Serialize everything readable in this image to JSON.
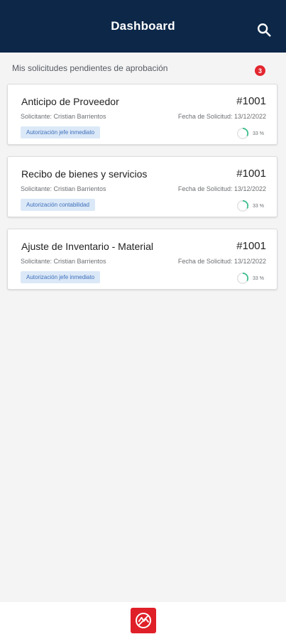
{
  "header": {
    "title": "Dashboard",
    "search_icon": "search-icon"
  },
  "section": {
    "title": "Mis solicitudes pendientes de aprobación",
    "count": "3"
  },
  "requests": [
    {
      "title": "Anticipo de Proveedor",
      "number": "#1001",
      "requester": "Solicitante: Cristian Barrientos",
      "date": "Fecha de Solicitud: 13/12/2022",
      "status": "Autorización jefe inmediato",
      "progress_label": "33 %",
      "progress": 0.33
    },
    {
      "title": "Recibo de bienes y servicios",
      "number": "#1001",
      "requester": "Solicitante: Cristian Barrientos",
      "date": "Fecha de Solicitud: 13/12/2022",
      "status": "Autorización contabilidad",
      "progress_label": "33 %",
      "progress": 0.33
    },
    {
      "title": "Ajuste de Inventario - Material",
      "number": "#1001",
      "requester": "Solicitante: Cristian Barrientos",
      "date": "Fecha de Solicitud: 13/12/2022",
      "status": "Autorización jefe inmediato",
      "progress_label": "33 %",
      "progress": 0.33
    }
  ],
  "colors": {
    "app_bar": "#0c2748",
    "badge": "#e3262f",
    "tag_bg": "#dbe8f7",
    "tag_text": "#3c6fbc",
    "progress": "#3fbf8e",
    "logo": "#e02029"
  },
  "footer": {
    "logo_icon": "company-logo-icon"
  }
}
